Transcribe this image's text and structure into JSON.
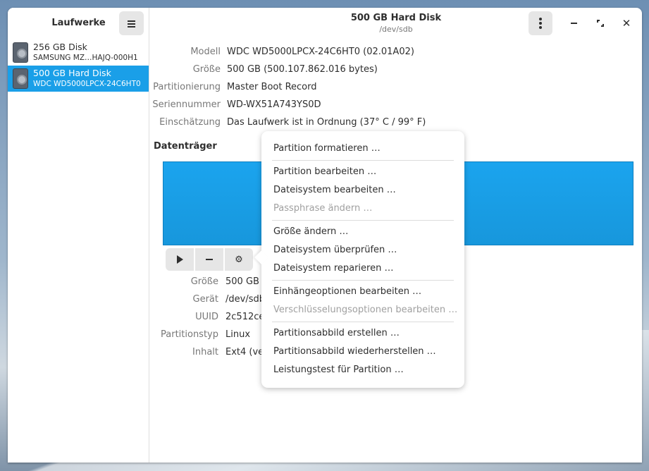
{
  "sidebar": {
    "title": "Laufwerke",
    "drives": [
      {
        "name": "256 GB Disk",
        "model": "SAMSUNG MZ…HAJQ-000H1",
        "selected": false
      },
      {
        "name": "500 GB Hard Disk",
        "model": "WDC WD5000LPCX-24C6HT0",
        "selected": true
      }
    ]
  },
  "header": {
    "title": "500 GB Hard Disk",
    "subtitle": "/dev/sdb"
  },
  "disk_info": [
    {
      "label": "Modell",
      "value": "WDC WD5000LPCX-24C6HT0 (02.01A02)"
    },
    {
      "label": "Größe",
      "value": "500 GB (500.107.862.016 bytes)"
    },
    {
      "label": "Partitionierung",
      "value": "Master Boot Record"
    },
    {
      "label": "Seriennummer",
      "value": "WD-WX51A743YS0D"
    },
    {
      "label": "Einschätzung",
      "value": "Das Laufwerk ist in Ordnung (37° C / 99° F)"
    }
  ],
  "volumes_section": {
    "title": "Datenträger"
  },
  "volume_props": [
    {
      "label": "Größe",
      "value": "500 GB"
    },
    {
      "label": "Gerät",
      "value": "/dev/sdb"
    },
    {
      "label": "UUID",
      "value": "2c512ce"
    },
    {
      "label": "Partitionstyp",
      "value": "Linux"
    },
    {
      "label": "Inhalt",
      "value": "Ext4 (ve"
    }
  ],
  "context_menu": {
    "groups": [
      [
        {
          "label": "Partition formatieren …",
          "enabled": true
        }
      ],
      [
        {
          "label": "Partition bearbeiten …",
          "enabled": true
        },
        {
          "label": "Dateisystem bearbeiten …",
          "enabled": true
        },
        {
          "label": "Passphrase ändern …",
          "enabled": false
        }
      ],
      [
        {
          "label": "Größe ändern …",
          "enabled": true
        },
        {
          "label": "Dateisystem überprüfen …",
          "enabled": true
        },
        {
          "label": "Dateisystem reparieren …",
          "enabled": true
        }
      ],
      [
        {
          "label": "Einhängeoptionen bearbeiten …",
          "enabled": true
        },
        {
          "label": "Verschlüsselungsoptionen bearbeiten …",
          "enabled": false
        }
      ],
      [
        {
          "label": "Partitionsabbild erstellen …",
          "enabled": true
        },
        {
          "label": "Partitionsabbild wiederherstellen …",
          "enabled": true
        },
        {
          "label": "Leistungstest für Partition …",
          "enabled": true
        }
      ]
    ]
  },
  "icons": {
    "drive": "harddisk-icon",
    "hamburger": "hamburger-menu-icon",
    "kebab": "kebab-menu-icon",
    "play": "play-icon",
    "minus": "minus-icon",
    "gears": "gears-icon"
  },
  "colors": {
    "accent": "#1a9fe8",
    "volume_fill": "#1ba4ee"
  }
}
